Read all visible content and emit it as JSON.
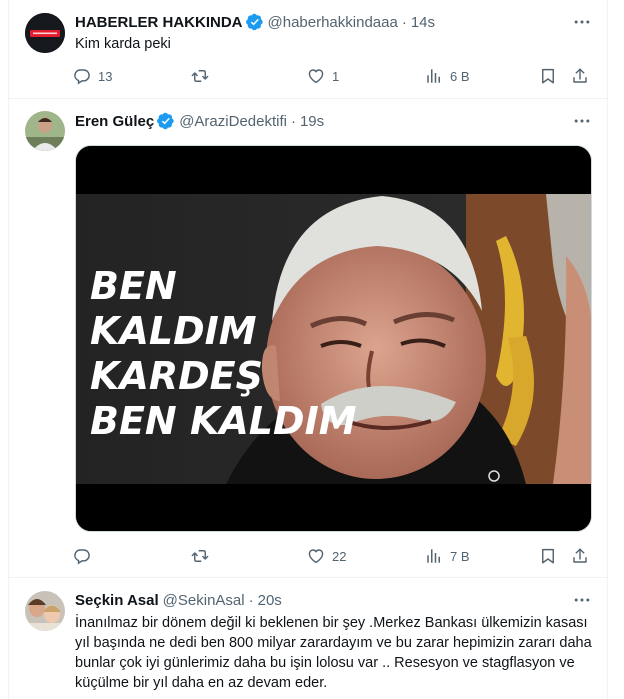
{
  "tweets": [
    {
      "name": "HABERLER HAKKINDA",
      "handle": "@haberhakkindaaa",
      "time": "14s",
      "text": "Kim karda peki",
      "replies": "13",
      "retweets": "",
      "likes": "1",
      "views": "6 B",
      "avatar_text": "haberler hakkında"
    },
    {
      "name": "Eren Güleç",
      "handle": "@AraziDedektifi",
      "time": "19s",
      "text": "",
      "media_text": [
        "BEN",
        "KALDIM",
        "KARDEŞ",
        "BEN KALDIM"
      ],
      "replies": "",
      "retweets": "",
      "likes": "22",
      "views": "7 B"
    },
    {
      "name": "Seçkin Asal",
      "handle": "@SekinAsal",
      "time": "20s",
      "text": "İnanılmaz bir dönem değil ki beklenen bir şey .Merkez Bankası ülkemizin kasası yıl başında ne dedi ben 800 milyar zarardayım ve bu zarar hepimizin zararı daha bunlar çok iyi günlerimiz daha bu işin lolosu var .. Resesyon ve stagflasyon ve küçülme bir yıl daha en az devam eder."
    }
  ],
  "dot": "·",
  "colors": {
    "verified": "#1d9bf0",
    "secondary": "#536471",
    "border": "#eff3f4"
  },
  "icons": [
    "verified-badge-icon",
    "more-icon",
    "reply-icon",
    "retweet-icon",
    "like-icon",
    "views-icon",
    "bookmark-icon",
    "share-icon"
  ]
}
